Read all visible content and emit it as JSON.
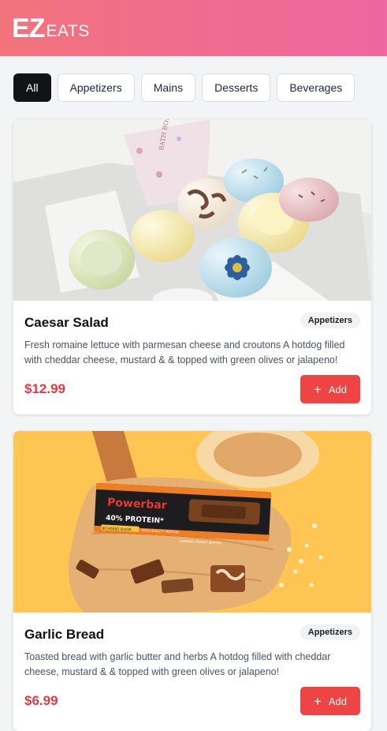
{
  "brand": {
    "logo_main": "EZ",
    "logo_sub": "EATS"
  },
  "filters": [
    {
      "label": "All",
      "active": true
    },
    {
      "label": "Appetizers",
      "active": false
    },
    {
      "label": "Mains",
      "active": false
    },
    {
      "label": "Desserts",
      "active": false
    },
    {
      "label": "Beverages",
      "active": false
    }
  ],
  "items": [
    {
      "title": "Caesar Salad",
      "category": "Appetizers",
      "description": "Fresh romaine lettuce with parmesan cheese and croutons A hotdog filled with cheddar cheese, mustard & & topped with green olives or jalapeno!",
      "price": "$12.99",
      "add_label": "Add",
      "add_icon": "plus-icon",
      "image": "bath-bombs-box-photo",
      "box_text": "BATH BOMBS"
    },
    {
      "title": "Garlic Bread",
      "category": "Appetizers",
      "description": "Toasted bread with garlic butter and herbs A hotdog filled with cheddar cheese, mustard & & topped with green olives or jalapeno!",
      "price": "$6.99",
      "add_label": "Add",
      "add_icon": "plus-icon",
      "image": "protein-bar-photo",
      "bar_brand": "Powerbar",
      "bar_text": "40% PROTEIN*",
      "bar_tag1": "NO ADDED SUGAR",
      "bar_tag2": "HIGH QUALITY PROTEIN",
      "bar_flavor": "CARAMEL PEANUT BUTTER"
    }
  ],
  "colors": {
    "accent": "#ef4444",
    "price": "#e53945",
    "header_from": "#f2737c",
    "header_to": "#ef66a0"
  }
}
